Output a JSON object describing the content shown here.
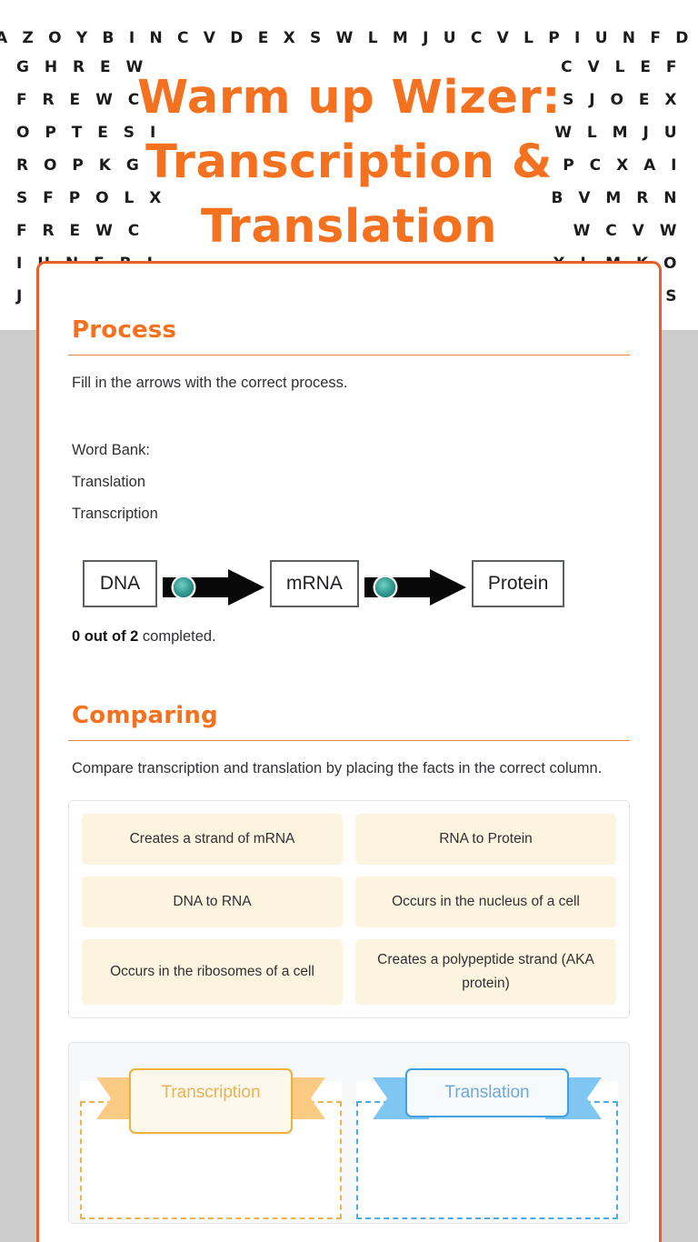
{
  "header": {
    "title_lines": [
      "Warm up Wizer:",
      "Transcription &",
      "Translation"
    ],
    "accent_color": "#F4711F",
    "letter_rows": [
      {
        "full": "Q F L K M T R E A Z O Y B I N C V D E X S W L M J U C V L P I U N F D Q X U J I Y T J X"
      },
      {
        "left": "G H R E W",
        "right": "C V L E F"
      },
      {
        "left": "F R E W C",
        "right": "S J O E X"
      },
      {
        "left": "O P T E S I",
        "right": "W L M J U"
      },
      {
        "left": "R O P K G",
        "right": "P C X A I"
      },
      {
        "left": "S F P O L X",
        "right": "B V M R N"
      },
      {
        "left": "F R E W C",
        "right": "W C V W"
      },
      {
        "left": "I U N E R I",
        "right": "X L M K O"
      },
      {
        "left": "J L",
        "right": "L S"
      }
    ]
  },
  "process": {
    "title": "Process",
    "description": "Fill in the arrows with the correct process.",
    "word_bank_label": "Word Bank:",
    "word_bank": [
      "Translation",
      "Transcription"
    ],
    "flow": {
      "nodes": [
        "DNA",
        "mRNA",
        "Protein"
      ],
      "slot_icon": "drop-target-dot",
      "arrow_color": "#080808",
      "dot_color": "#2f958c"
    },
    "progress_count": "0 out of 2",
    "progress_suffix": " completed."
  },
  "comparing": {
    "title": "Comparing",
    "description": "Compare transcription and translation by placing the facts in the correct column.",
    "facts": [
      "Creates a strand of mRNA",
      "RNA to Protein",
      "DNA to RNA",
      "Occurs in the nucleus of a cell",
      "Occurs in the ribosomes of a cell",
      "Creates a polypeptide strand (AKA protein)"
    ],
    "zones": [
      {
        "label": "Transcription",
        "color": "#EFB13E"
      },
      {
        "label": "Translation",
        "color": "#3FA2E8"
      }
    ]
  }
}
